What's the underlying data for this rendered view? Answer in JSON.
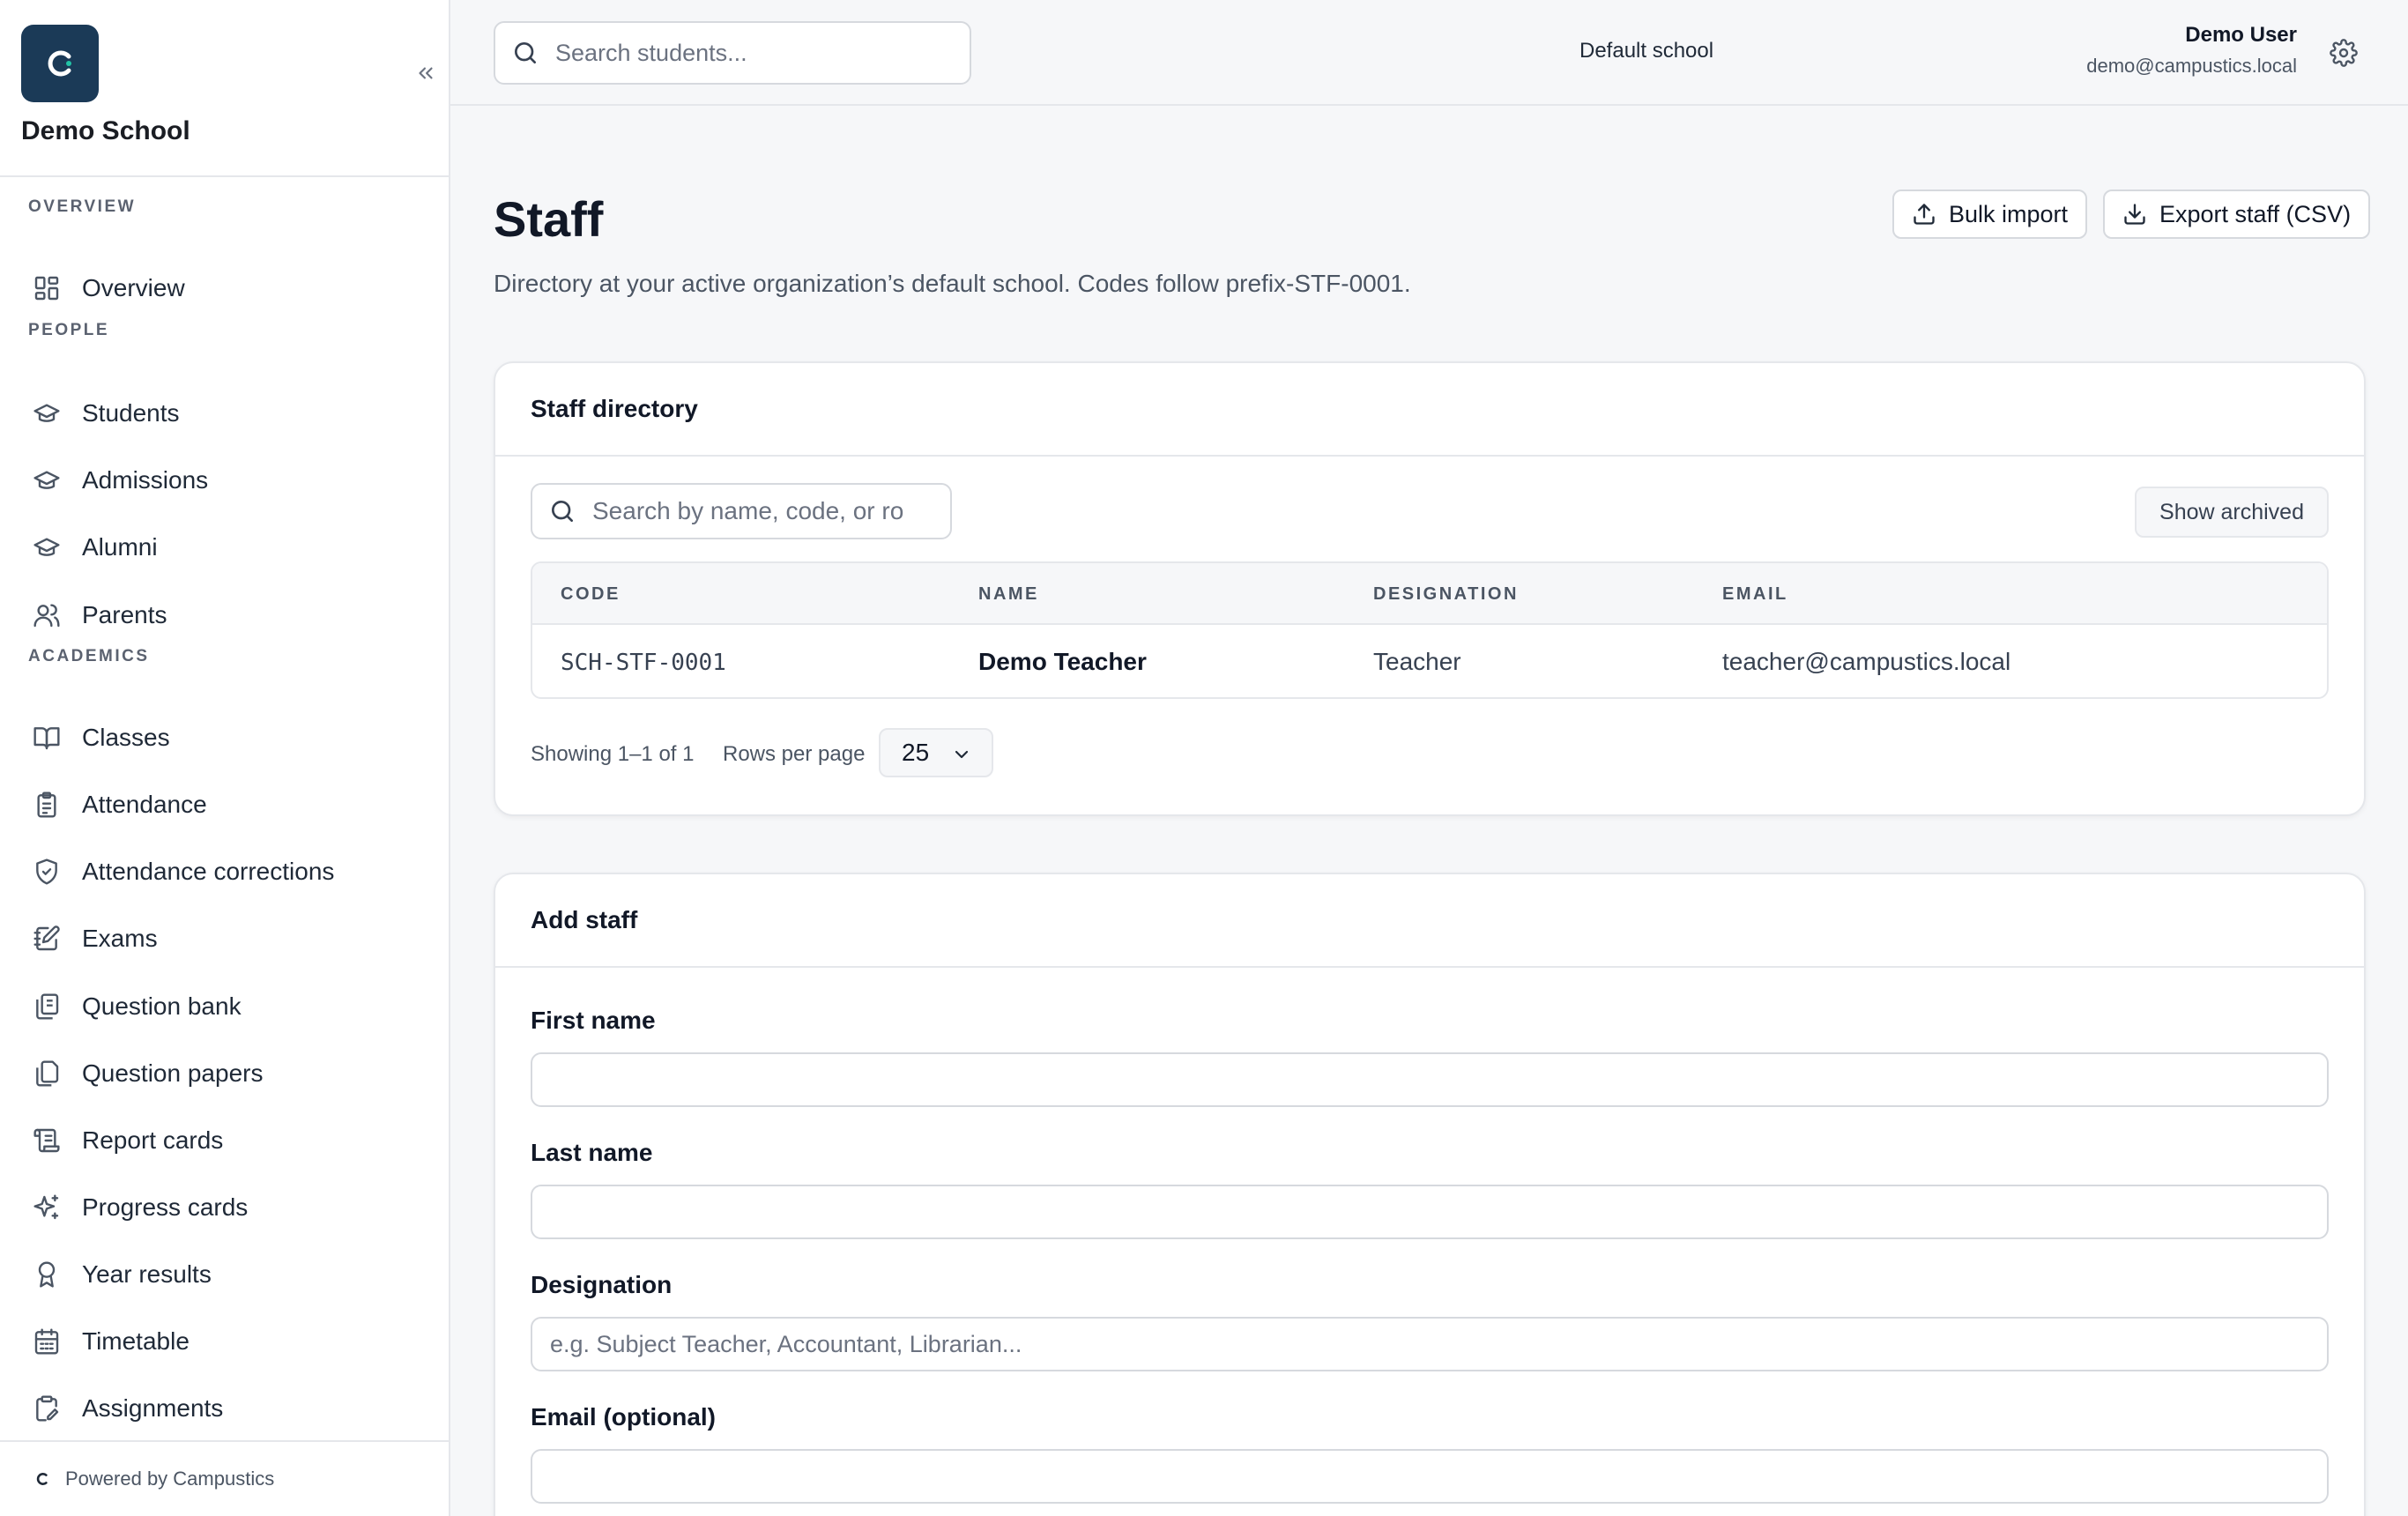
{
  "sidebar": {
    "school_name": "Demo School",
    "sections": {
      "overview": "OVERVIEW",
      "people": "PEOPLE",
      "academics": "ACADEMICS"
    },
    "items": [
      {
        "label": "Overview",
        "icon": "layout-dashboard-icon"
      },
      {
        "label": "Students",
        "icon": "graduation-cap-icon"
      },
      {
        "label": "Admissions",
        "icon": "graduation-cap-icon"
      },
      {
        "label": "Alumni",
        "icon": "graduation-cap-icon"
      },
      {
        "label": "Parents",
        "icon": "users-icon"
      },
      {
        "label": "Classes",
        "icon": "book-open-icon"
      },
      {
        "label": "Attendance",
        "icon": "clipboard-list-icon"
      },
      {
        "label": "Attendance corrections",
        "icon": "shield-check-icon"
      },
      {
        "label": "Exams",
        "icon": "notebook-pen-icon"
      },
      {
        "label": "Question bank",
        "icon": "library-icon"
      },
      {
        "label": "Question papers",
        "icon": "copy-icon"
      },
      {
        "label": "Report cards",
        "icon": "scroll-text-icon"
      },
      {
        "label": "Progress cards",
        "icon": "sparkles-icon"
      },
      {
        "label": "Year results",
        "icon": "award-icon"
      },
      {
        "label": "Timetable",
        "icon": "calendar-icon"
      },
      {
        "label": "Assignments",
        "icon": "clipboard-pen-icon"
      }
    ],
    "footer": "Powered by Campustics"
  },
  "topbar": {
    "search_placeholder": "Search students...",
    "school": "Default school",
    "user_name": "Demo User",
    "user_email": "demo@campustics.local"
  },
  "page": {
    "title": "Staff",
    "description": "Directory at your active organization’s default school. Codes follow prefix-STF-0001.",
    "bulk_import": "Bulk import",
    "export": "Export staff (CSV)"
  },
  "directory": {
    "title": "Staff directory",
    "search_placeholder": "Search by name, code, or ro",
    "show_archived": "Show archived",
    "columns": [
      "CODE",
      "NAME",
      "DESIGNATION",
      "EMAIL"
    ],
    "rows": [
      {
        "code": "SCH-STF-0001",
        "name": "Demo Teacher",
        "designation": "Teacher",
        "email": "teacher@campustics.local"
      }
    ],
    "showing": "Showing 1–1 of 1",
    "rows_per_page_label": "Rows per page",
    "rows_per_page": "25"
  },
  "add_staff": {
    "title": "Add staff",
    "first_name_label": "First name",
    "last_name_label": "Last name",
    "designation_label": "Designation",
    "designation_placeholder": "e.g. Subject Teacher, Accountant, Librarian...",
    "email_label": "Email (optional)"
  },
  "colors": {
    "brand": "#1b3a57",
    "brand_accent": "#22c3a6",
    "background": "#f6f7f9",
    "border": "#e5e7eb"
  }
}
